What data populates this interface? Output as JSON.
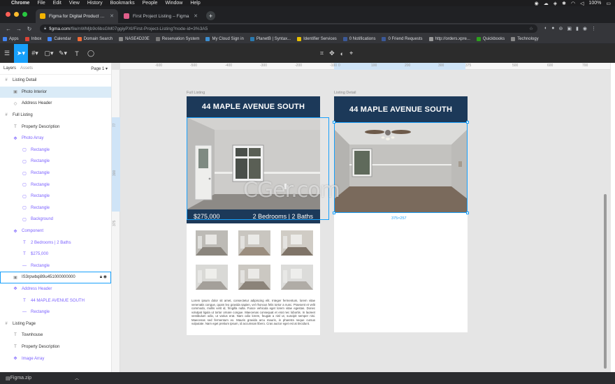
{
  "menubar": {
    "app": "Chrome",
    "items": [
      "File",
      "Edit",
      "View",
      "History",
      "Bookmarks",
      "People",
      "Window",
      "Help"
    ],
    "battery": "100%"
  },
  "tabs": [
    {
      "title": "Figma for Digital Product Desig",
      "active": true,
      "color": "#f4b400"
    },
    {
      "title": "First Project Listing – Figma",
      "active": false,
      "color": "#e05e8a"
    }
  ],
  "address": {
    "host": "figma.com",
    "path": "/file/nWMjb9c6bsGM07ggiyPXl/First-Project-Listing?node-id=3%3A5"
  },
  "bookmarks": [
    {
      "label": "Apps",
      "color": "#4285f4"
    },
    {
      "label": "Inbox",
      "color": "#db4437"
    },
    {
      "label": "Calendar",
      "color": "#4285f4"
    },
    {
      "label": "Domain Search",
      "color": "#f06a35"
    },
    {
      "label": "NASE4D20E",
      "color": "#888888"
    },
    {
      "label": "Reservation System",
      "color": "#777777"
    },
    {
      "label": "My Cloud Sign in",
      "color": "#3d8fd1"
    },
    {
      "label": "PlanetB | Syntax...",
      "color": "#2a7ab0"
    },
    {
      "label": "Identifier Services",
      "color": "#e8c000"
    },
    {
      "label": "0 Notifications",
      "color": "#3b5998"
    },
    {
      "label": "0 Friend Requests",
      "color": "#3b5998"
    },
    {
      "label": "http://orders.xpre...",
      "color": "#999999"
    },
    {
      "label": "Quickbooks",
      "color": "#2ca01c"
    },
    {
      "label": "Technology",
      "color": "#888888"
    }
  ],
  "layers_panel": {
    "tab_layers": "Layers",
    "tab_assets": "Assets",
    "page": "Page 1",
    "items": [
      {
        "label": "Listing Detail",
        "icon": "#",
        "indent": 0,
        "kind": "frame"
      },
      {
        "label": "Photo Interior",
        "icon": "▣",
        "indent": 1,
        "selected": true
      },
      {
        "label": "Address Header",
        "icon": "◇",
        "indent": 1
      },
      {
        "label": "Full Listing",
        "icon": "#",
        "indent": 0,
        "kind": "frame"
      },
      {
        "label": "Property Description",
        "icon": "T",
        "indent": 1
      },
      {
        "label": "Photo Array",
        "icon": "✥",
        "indent": 1,
        "purple": true
      },
      {
        "label": "Rectangle",
        "icon": "▢",
        "indent": 2,
        "purple": true
      },
      {
        "label": "Rectangle",
        "icon": "▢",
        "indent": 2,
        "purple": true
      },
      {
        "label": "Rectangle",
        "icon": "▢",
        "indent": 2,
        "purple": true
      },
      {
        "label": "Rectangle",
        "icon": "▢",
        "indent": 2,
        "purple": true
      },
      {
        "label": "Rectangle",
        "icon": "▢",
        "indent": 2,
        "purple": true
      },
      {
        "label": "Rectangle",
        "icon": "▢",
        "indent": 2,
        "purple": true
      },
      {
        "label": "Background",
        "icon": "▢",
        "indent": 2,
        "purple": true
      },
      {
        "label": "Component",
        "icon": "✥",
        "indent": 1,
        "purple": true
      },
      {
        "label": "2 Bedrooms | 2 Baths",
        "icon": "T",
        "indent": 2,
        "purple": true
      },
      {
        "label": "$275,000",
        "icon": "T",
        "indent": 2,
        "purple": true
      },
      {
        "label": "Rectangle",
        "icon": "—",
        "indent": 2,
        "purple": true
      },
      {
        "label": "IS3rpwbqi89u451000000000",
        "icon": "▣",
        "indent": 1,
        "boxed": true
      },
      {
        "label": "Address Header",
        "icon": "✥",
        "indent": 1,
        "purple": true
      },
      {
        "label": "44 MAPLE AVENUE SOUTH",
        "icon": "T",
        "indent": 2,
        "purple": true
      },
      {
        "label": "Rectangle",
        "icon": "—",
        "indent": 2,
        "purple": true
      },
      {
        "label": "Listing Page",
        "icon": "#",
        "indent": 0,
        "kind": "frame"
      },
      {
        "label": "Townhouse",
        "icon": "T",
        "indent": 1
      },
      {
        "label": "Property Description",
        "icon": "T",
        "indent": 1
      },
      {
        "label": "Image Array",
        "icon": "✥",
        "indent": 1,
        "purple": true
      }
    ]
  },
  "ruler": {
    "top_ticks": [
      "-600",
      "-500",
      "-400",
      "-300",
      "-200",
      "-100",
      "0",
      "100",
      "200",
      "300",
      "375",
      "500",
      "600",
      "700"
    ],
    "left_ticks": [
      "77",
      "300",
      "375"
    ]
  },
  "canvas": {
    "full_listing": {
      "label": "Full Listing",
      "address": "44 MAPLE AVENUE SOUTH",
      "price": "$275,000",
      "beds_baths": "2 Bedrooms | 2 Baths",
      "description": "Lorem ipsum dolor sit amet, consectetur adipiscing elit. Integer fermentum, lorem vitae venenatis congue, quam leo gravida sapien, vel rhoncus felis tortor a nunc. Praesent et velit commodo, mollis velit id, fringilla nulla. Fusce vehicula eget lorem vitae egestas. Donec volutpat ligula ut tortor ornare congue. Maecenas consequat et erat nec lobortis. In laoreet vestibulum odio, ut varius erat. Nam odio lorem, feugiat a nisl ut, suscipit semper nisi. Maecenas sed fermentum ex. Mauris gravida arcu mauris, in pharetra neque cursus vulputate. Nam eget pretium ipsum, id accumsan libero. Cras auctor eget est at tincidunt."
    },
    "listing_detail": {
      "label": "Listing Detail",
      "address": "44 MAPLE AVENUE SOUTH",
      "dimensions": "375×257"
    },
    "watermark": "CGer.com"
  },
  "downloads": {
    "file": "Figma.zip"
  }
}
